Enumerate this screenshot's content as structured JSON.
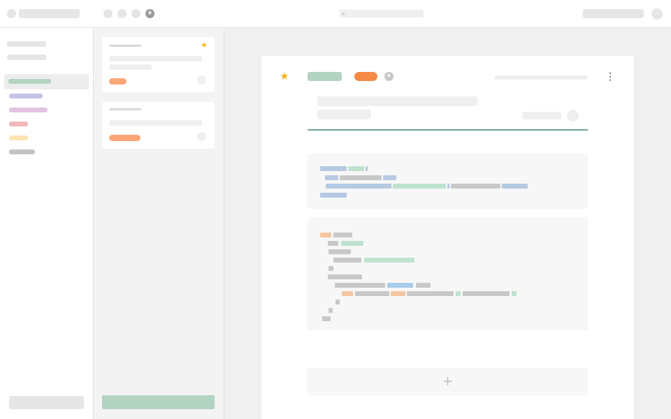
{
  "colors": {
    "accent_green": "#b3d3c3",
    "accent_orange": "#f58a45",
    "star": "#f2b619",
    "divider_teal": "#6aa592"
  },
  "icons": {
    "top_add": "plus-icon",
    "search": "search-icon",
    "favorite": "star-icon",
    "more": "more-vertical-icon",
    "add_block": "plus-icon"
  },
  "topbar": {
    "add_glyph": "+",
    "search_glyph": "⌕"
  },
  "doc": {
    "star_glyph": "★",
    "tag_add_glyph": "+",
    "more_glyph": "⋮",
    "add_block_glyph": "+"
  },
  "notelist": {
    "card_star_glyph": "★"
  }
}
